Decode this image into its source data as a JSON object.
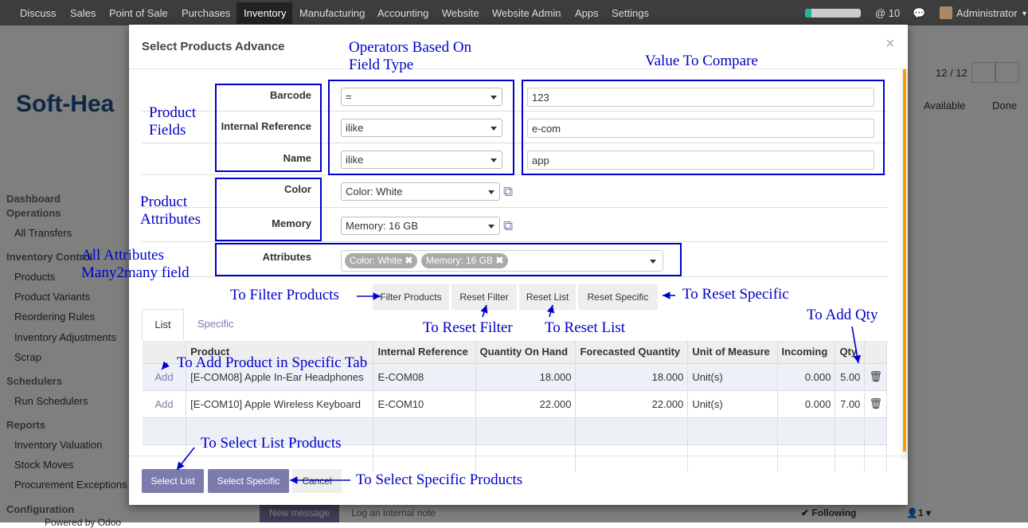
{
  "topbar": {
    "menus": [
      "Discuss",
      "Sales",
      "Point of Sale",
      "Purchases",
      "Inventory",
      "Manufacturing",
      "Accounting",
      "Website",
      "Website Admin",
      "Apps",
      "Settings"
    ],
    "msg_count": "@ 10",
    "user": "Administrator"
  },
  "background": {
    "logo": "Soft-Hea",
    "pager": "12 / 12",
    "status_available": "Available",
    "status_done": "Done",
    "sidebar": {
      "dashboard": "Dashboard",
      "operations": "Operations",
      "all_transfers": "All Transfers",
      "inv_control": "Inventory Control",
      "products": "Products",
      "product_variants": "Product Variants",
      "reordering_rules": "Reordering Rules",
      "inventory_adjustments": "Inventory Adjustments",
      "scrap": "Scrap",
      "schedulers": "Schedulers",
      "run_schedulers": "Run Schedulers",
      "reports": "Reports",
      "inventory_valuation": "Inventory Valuation",
      "stock_moves": "Stock Moves",
      "procurement_exceptions": "Procurement Exceptions",
      "configuration": "Configuration",
      "powered": "Powered by Odoo"
    },
    "new_message": "New message",
    "log_note": "Log an internal note",
    "following": "Following",
    "followers": "1"
  },
  "modal": {
    "title": "Select Products Advance",
    "close": "×",
    "fields": [
      {
        "label": "Barcode",
        "operator": "=",
        "value": "123"
      },
      {
        "label": "Internal Reference",
        "operator": "ilike",
        "value": "e-com"
      },
      {
        "label": "Name",
        "operator": "ilike",
        "value": "app"
      }
    ],
    "attributes": [
      {
        "label": "Color",
        "value": "Color: White"
      },
      {
        "label": "Memory",
        "value": "Memory: 16 GB"
      }
    ],
    "all_attributes": {
      "label": "Attributes",
      "tags": [
        "Color: White",
        "Memory: 16 GB"
      ]
    },
    "buttons": {
      "filter": "Filter Products",
      "reset_filter": "Reset Filter",
      "reset_list": "Reset List",
      "reset_specific": "Reset Specific"
    },
    "tabs": [
      "List",
      "Specific"
    ],
    "table": {
      "headers": [
        "Product",
        "Internal Reference",
        "Quantity On Hand",
        "Forecasted Quantity",
        "Unit of Measure",
        "Incoming",
        "Qty"
      ],
      "rows": [
        {
          "action": "Add",
          "product": "[E-COM08] Apple In-Ear Headphones",
          "ref": "E-COM08",
          "on_hand": "18.000",
          "forecast": "18.000",
          "uom": "Unit(s)",
          "incoming": "0.000",
          "qty": "5.00"
        },
        {
          "action": "Add",
          "product": "[E-COM10] Apple Wireless Keyboard",
          "ref": "E-COM10",
          "on_hand": "22.000",
          "forecast": "22.000",
          "uom": "Unit(s)",
          "incoming": "0.000",
          "qty": "7.00"
        }
      ]
    },
    "footer": {
      "select_list": "Select List",
      "select_specific": "Select Specific",
      "cancel": "Cancel"
    }
  },
  "annotations": {
    "operators": "Operators Based On Field Type",
    "operators_l1": "Operators Based On",
    "operators_l2": "Field Type",
    "value_compare": "Value To Compare",
    "product_fields_l1": "Product",
    "product_fields_l2": "Fields",
    "product_attr_l1": "Product",
    "product_attr_l2": "Attributes",
    "all_attr_l1": "All Attributes",
    "all_attr_l2": "Many2many field",
    "to_filter": "To Filter Products",
    "to_reset_specific": "To Reset Specific",
    "to_reset_filter": "To Reset Filter",
    "to_reset_list": "To Reset List",
    "to_add_qty": "To Add Qty",
    "to_add_specific": "To Add Product in Specific Tab",
    "to_select_list": "To Select List Products",
    "to_select_specific": "To Select Specific Products"
  },
  "colors": {
    "accent": "#7c7bad",
    "annotation": "#0000c8",
    "topbar": "#3d3d3d"
  }
}
